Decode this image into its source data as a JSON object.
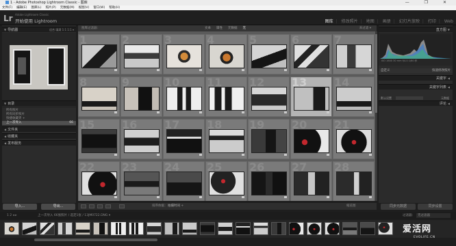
{
  "window": {
    "title": "1 - Adobe Photoshop Lightroom Classic - 图库",
    "controls": "— ❐ ✕"
  },
  "menu": [
    "文件(F)",
    "编辑(E)",
    "图库(L)",
    "照片(P)",
    "元数据(M)",
    "视图(V)",
    "窗口(W)",
    "帮助(H)"
  ],
  "identity": {
    "logo": "Lr",
    "small": "Adobe Lightroom Classic",
    "brand": "开始使用 Lightroom"
  },
  "modules": [
    "图库",
    "修改照片",
    "地图",
    "画册",
    "幻灯片放映",
    "打印",
    "Web"
  ],
  "left": {
    "navigator": "导航器",
    "nav_opts": "适合 填满 1:1 1:1 ▾",
    "catalog": "目录",
    "catalog_items": [
      {
        "label": "所有照片",
        "count": ""
      },
      {
        "label": "所有同步照片",
        "count": ""
      },
      {
        "label": "快捷收藏夹 +",
        "count": ""
      },
      {
        "label": "上一次导入",
        "count": "66"
      }
    ],
    "folders": "文件夹",
    "collections": "收藏夹",
    "publish": "发布服务",
    "import": "导入...",
    "export": "导出..."
  },
  "center": {
    "filter_title": "图库过滤器：",
    "filter_opts": [
      "文本",
      "属性",
      "元数据",
      "无"
    ],
    "filter_right": "未过滤 ▾"
  },
  "grid_numbers": [
    "1",
    "2",
    "3",
    "4",
    "5",
    "6",
    "7",
    "8",
    "9",
    "10",
    "11",
    "12",
    "13",
    "14",
    "15",
    "16",
    "17",
    "18",
    "19",
    "20",
    "21",
    "22",
    "23",
    "24",
    "25",
    "26",
    "27",
    "28"
  ],
  "toolbar": {
    "sort_label": "排序依据：",
    "sort_value": "拍摄时间 ÷",
    "thumbs": "缩览图"
  },
  "right": {
    "histogram": "直方图",
    "stats": "ISO 1600    30 mm    f/4.0    1/60 秒",
    "original": "原始照片",
    "quickdev": "自定义",
    "quickdev_label": "快速修改照片",
    "keywords": "关键字",
    "kw_list": "关键字列表",
    "kw_label": "默认设置",
    "kw_r": "元数据",
    "metadata": "评论",
    "sync": "同步元数据",
    "syncset": "同步设置"
  },
  "filmstrip": {
    "nav": "1 2 ◂ ▸",
    "source": "上一次导入  66张照片 / 选定1张 / 13JM0722.DNG ▾",
    "filter_label": "过滤器：",
    "filter_value": "无过滤器"
  },
  "watermark": {
    "big": "爱活网",
    "small": "EVOLIFE.CN"
  }
}
